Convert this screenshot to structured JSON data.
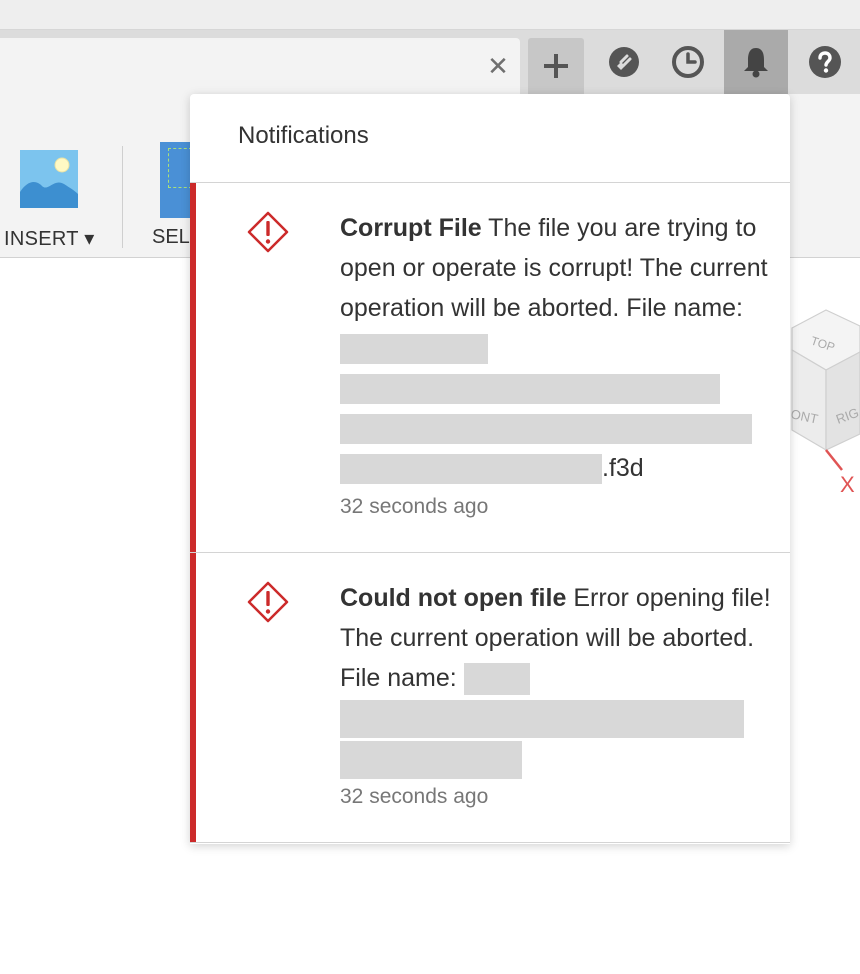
{
  "window": {
    "close_glyph": "✕",
    "toolbar_buttons": [
      {
        "name": "new-tab-button",
        "icon": "plus-icon"
      },
      {
        "name": "extensions-button",
        "icon": "plug-icon"
      },
      {
        "name": "history-button",
        "icon": "clock-icon"
      },
      {
        "name": "notifications-button",
        "icon": "bell-icon"
      },
      {
        "name": "help-button",
        "icon": "question-icon"
      }
    ]
  },
  "ribbon": {
    "insert_label": "INSERT ▾",
    "select_label": "SELE"
  },
  "notifications": {
    "title": "Notifications",
    "accent_color": "#cc2a2a",
    "items": [
      {
        "title": "Corrupt File",
        "message": "The file you are trying to open or operate is corrupt! The current operation will be aborted. File name:",
        "file_suffix": ".f3d",
        "time": "32 seconds ago"
      },
      {
        "title": "Could not open file",
        "message": "Error opening file! The current operation will be aborted. File name:",
        "time": "32 seconds ago"
      }
    ]
  }
}
